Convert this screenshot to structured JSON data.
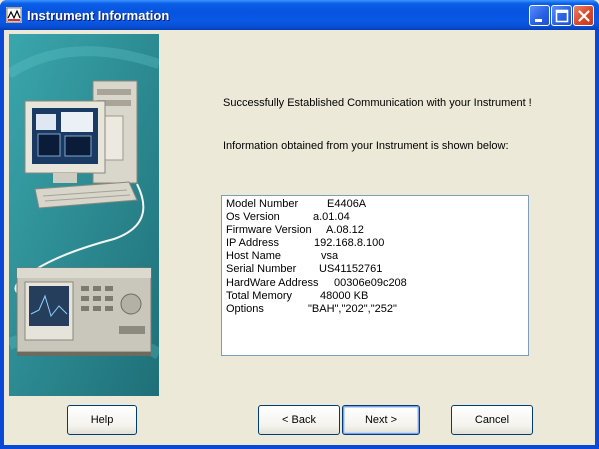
{
  "window": {
    "title": "Instrument Information",
    "controls": {
      "minimize": "minimize-icon",
      "maximize": "maximize-icon",
      "close": "close-icon"
    }
  },
  "messages": {
    "success": "Successfully Established Communication with your Instrument !",
    "info_intro": "Information obtained from your Instrument is shown below:"
  },
  "instrument_info": [
    {
      "label": "Model Number",
      "value": "E4406A"
    },
    {
      "label": "Os Version",
      "value": "a.01.04"
    },
    {
      "label": "Firmware Version",
      "value": "A.08.12"
    },
    {
      "label": "IP Address",
      "value": "192.168.8.100"
    },
    {
      "label": "Host Name",
      "value": "vsa"
    },
    {
      "label": "Serial Number",
      "value": "US41152761"
    },
    {
      "label": "HardWare Address",
      "value": "00306e09c208"
    },
    {
      "label": "Total Memory",
      "value": "48000 KB"
    },
    {
      "label": "Options",
      "value": "\"BAH\",\"202\",\"252\""
    }
  ],
  "buttons": {
    "help": "Help",
    "back": "< Back",
    "next": "Next >",
    "cancel": "Cancel"
  },
  "colors": {
    "titlebar": "#0a5ee8",
    "dialog_bg": "#ece9d8",
    "side_panel": "#2e8a92"
  }
}
